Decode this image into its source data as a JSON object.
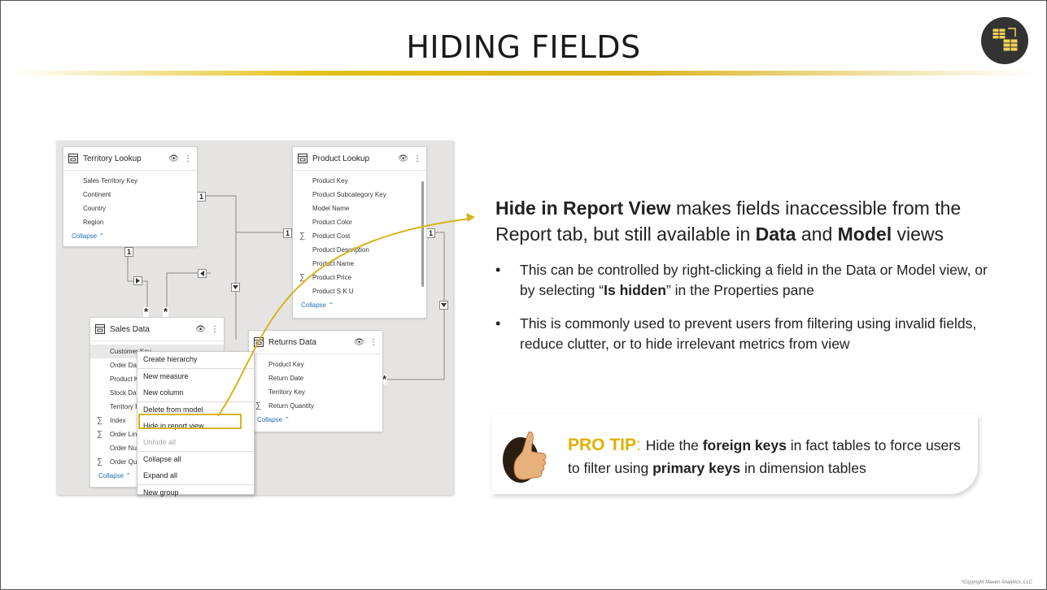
{
  "slide": {
    "title": "HIDING FIELDS",
    "copyright": "*Copyright Maven Analytics, LLC"
  },
  "tables": {
    "territory": {
      "title": "Territory Lookup",
      "fields": [
        "Sales Territory Key",
        "Continent",
        "Country",
        "Region"
      ],
      "collapse": "Collapse"
    },
    "product": {
      "title": "Product Lookup",
      "fields": [
        "Product Key",
        "Product Subcategory Key",
        "Model Name",
        "Product Color",
        "Product Cost",
        "Product Description",
        "Product Name",
        "Product Price",
        "Product S K U"
      ],
      "collapse": "Collapse"
    },
    "sales": {
      "title": "Sales Data",
      "fields": [
        "Customer Key",
        "Order Date",
        "Product Key",
        "Stock Date",
        "Territory Key",
        "Index",
        "Order Line Item",
        "Order Number",
        "Order Quantity"
      ],
      "collapse": "Collapse"
    },
    "returns": {
      "title": "Returns Data",
      "fields": [
        "Product Key",
        "Return Date",
        "Territory Key",
        "Return Quantity"
      ],
      "collapse": "Collapse"
    }
  },
  "relationships": {
    "one": "1",
    "many": "*"
  },
  "context_menu": {
    "items": [
      "Create hierarchy",
      "New measure",
      "New column",
      "Delete from model",
      "Hide in report view",
      "Unhide all",
      "Collapse all",
      "Expand all",
      "New group"
    ]
  },
  "content": {
    "headline_bold": "Hide in Report View",
    "headline_1": " makes fields inaccessible from the Report tab, but still available in ",
    "headline_data": "Data",
    "headline_and": " and ",
    "headline_model": "Model",
    "headline_end": " views",
    "bullet1_a": "This can be controlled by right-clicking a field in the Data or Model view, or by selecting “",
    "bullet1_b": "Is hidden",
    "bullet1_c": "” in the Properties pane",
    "bullet2": "This is commonly used to prevent users from filtering using invalid fields, reduce clutter, or to hide irrelevant metrics from view"
  },
  "protip": {
    "label": "PRO TIP",
    "colon": ": ",
    "t1": "Hide the ",
    "b1": "foreign keys",
    "t2": " in fact tables to force users to filter using ",
    "b2": "primary keys",
    "t3": " in dimension tables"
  },
  "colors": {
    "accent": "#e0b000",
    "rule": "#d9b21a",
    "link": "#1f6fb3"
  }
}
